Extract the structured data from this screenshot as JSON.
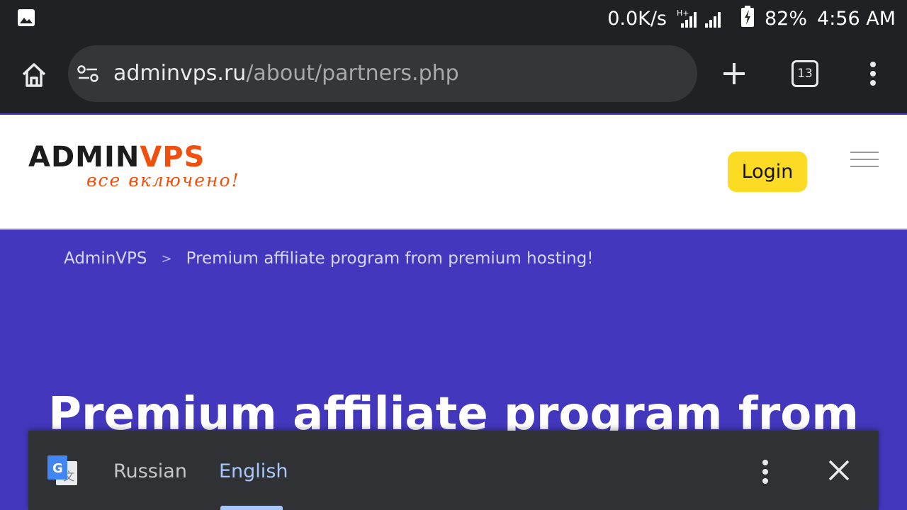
{
  "status_bar": {
    "speed": "0.0K/s",
    "network_type": "H+",
    "battery": "82%",
    "time": "4:56 AM"
  },
  "browser": {
    "url_domain": "adminvps.ru",
    "url_path": "/about/partners.php",
    "tab_count": "13"
  },
  "site": {
    "logo_main_dark": "ADMIN",
    "logo_main_v": "V",
    "logo_main_orange": "PS",
    "logo_tagline": "все включено!",
    "login_label": "Login",
    "brand_color": "#f0500e",
    "login_color": "#fbdb23",
    "hero_bg": "#4338bd"
  },
  "breadcrumb": {
    "home": "AdminVPS",
    "separator": ">",
    "current": "Premium affiliate program from premium hosting!"
  },
  "hero": {
    "title": "Premium affiliate program from"
  },
  "translate_bar": {
    "source_lang": "Russian",
    "target_lang": "English"
  }
}
